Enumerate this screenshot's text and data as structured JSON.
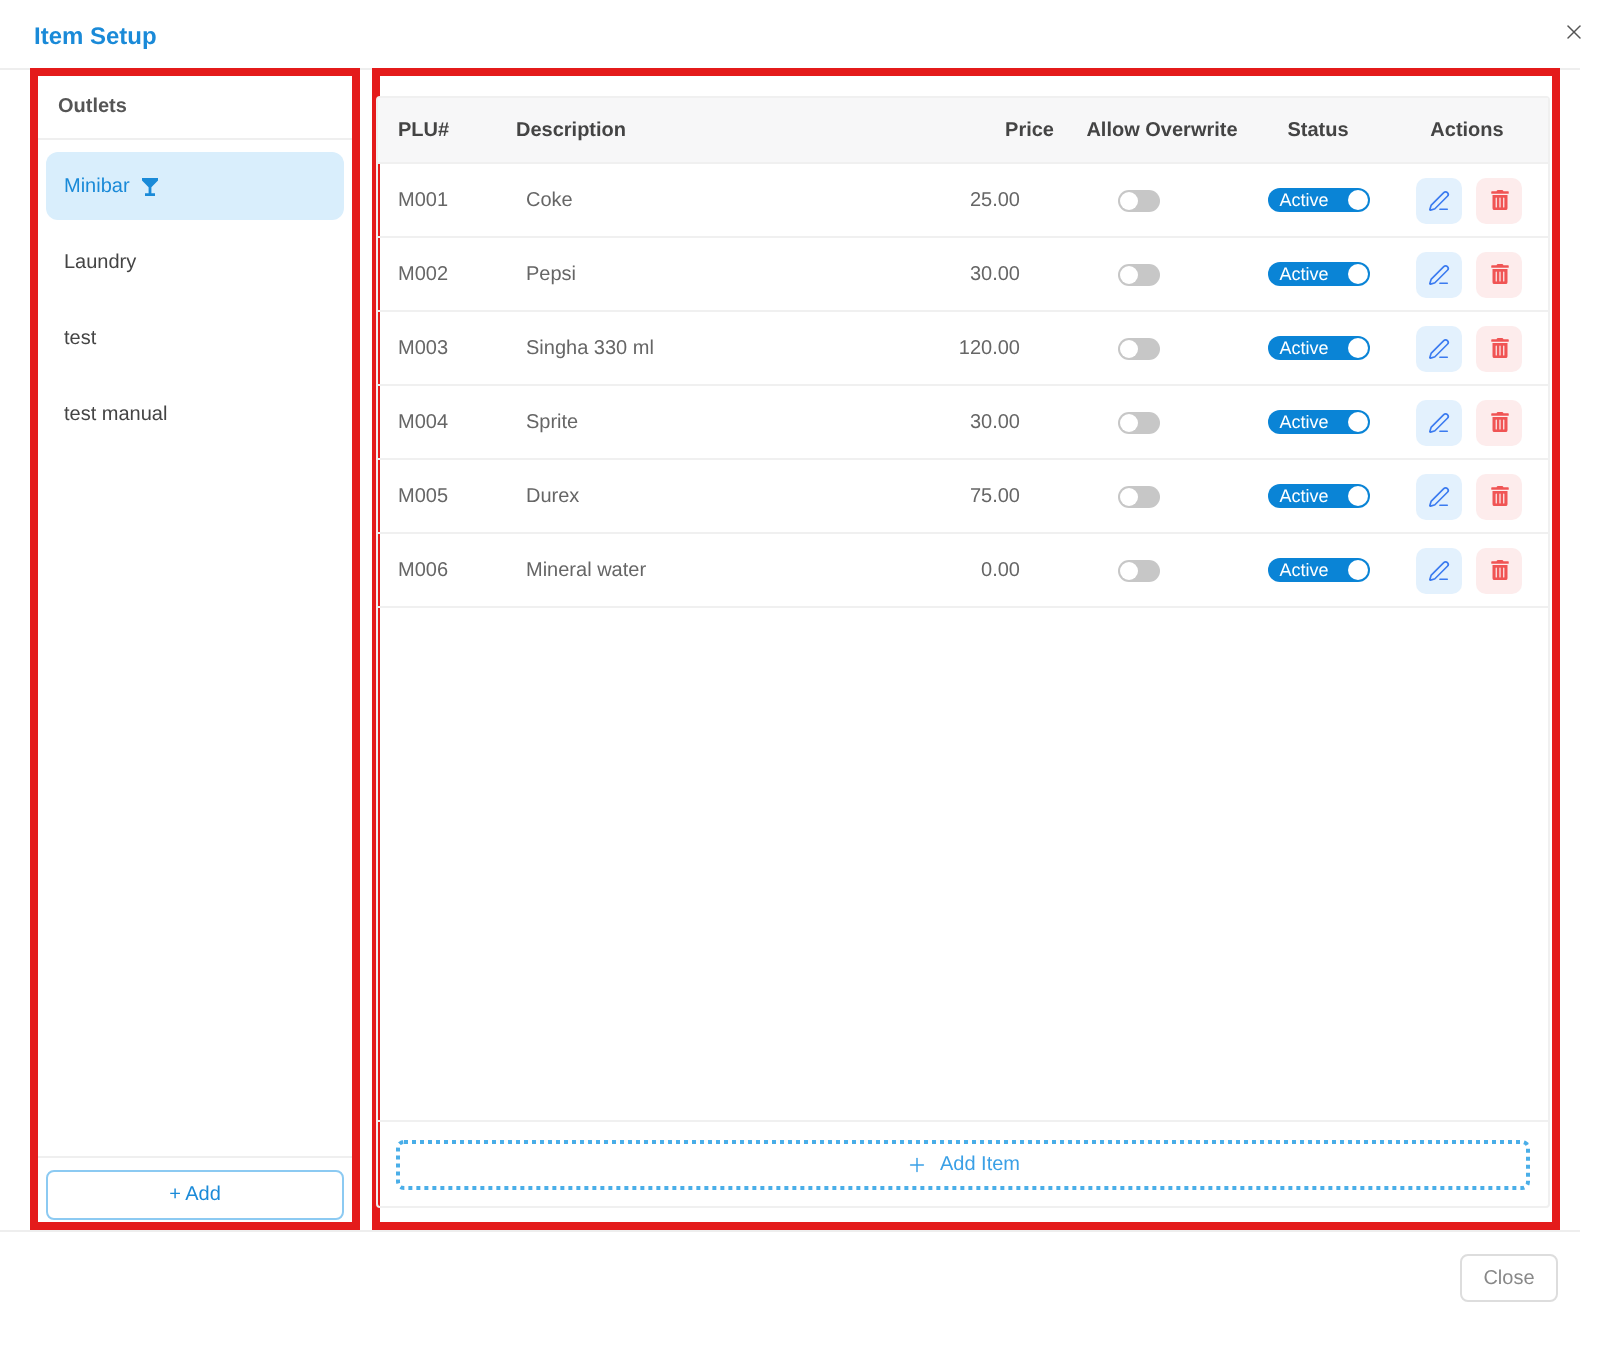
{
  "dialog": {
    "title": "Item Setup"
  },
  "outlets_panel": {
    "highlighted": true,
    "heading": "Outlets",
    "items": [
      {
        "label": "Minibar",
        "selected": true
      },
      {
        "label": "Laundry",
        "selected": false
      },
      {
        "label": "test",
        "selected": false
      },
      {
        "label": "test manual",
        "selected": false
      }
    ],
    "add_button": "+ Add"
  },
  "items_panel": {
    "highlighted": true,
    "columns": [
      "PLU#",
      "Description",
      "Price",
      "Allow Overwrite",
      "Status",
      "Actions"
    ],
    "rows": [
      {
        "plu": "M001",
        "description": "Coke",
        "price": "25.00",
        "allow_overwrite": false,
        "status": "Active",
        "active": true
      },
      {
        "plu": "M002",
        "description": "Pepsi",
        "price": "30.00",
        "allow_overwrite": false,
        "status": "Active",
        "active": true
      },
      {
        "plu": "M003",
        "description": "Singha 330 ml",
        "price": "120.00",
        "allow_overwrite": false,
        "status": "Active",
        "active": true
      },
      {
        "plu": "M004",
        "description": "Sprite",
        "price": "30.00",
        "allow_overwrite": false,
        "status": "Active",
        "active": true
      },
      {
        "plu": "M005",
        "description": "Durex",
        "price": "75.00",
        "allow_overwrite": false,
        "status": "Active",
        "active": true
      },
      {
        "plu": "M006",
        "description": "Mineral water",
        "price": "0.00",
        "allow_overwrite": false,
        "status": "Active",
        "active": true
      }
    ],
    "add_button": "Add Item"
  },
  "footer": {
    "close_button": "Close"
  }
}
